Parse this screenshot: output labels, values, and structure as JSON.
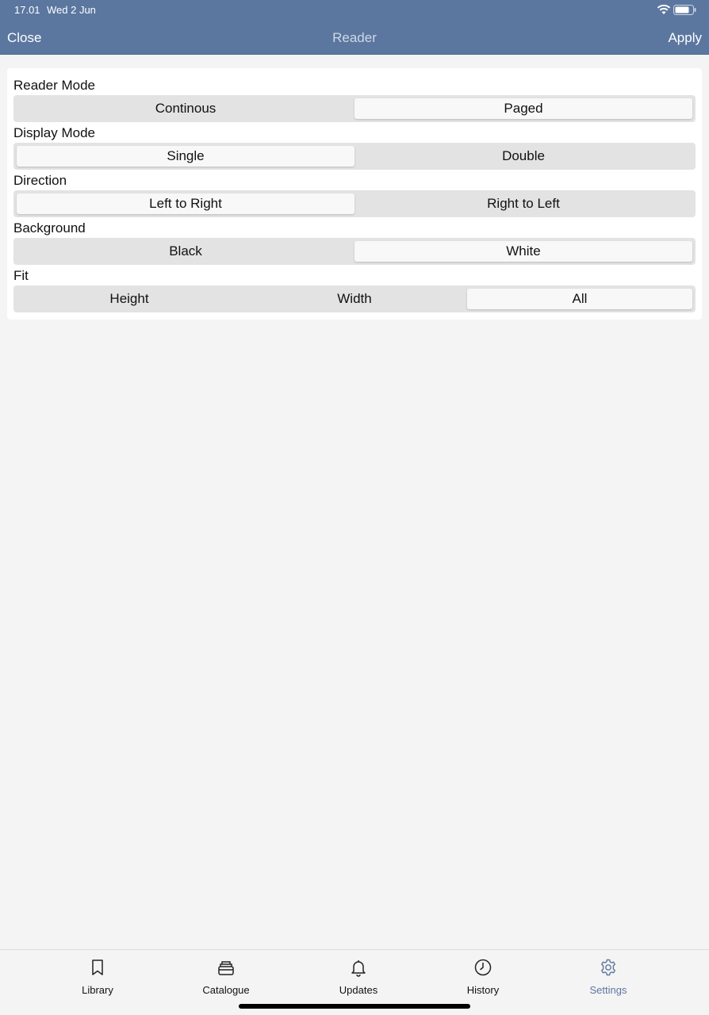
{
  "status": {
    "time": "17.01",
    "date": "Wed 2 Jun"
  },
  "nav": {
    "close_label": "Close",
    "title": "Reader",
    "apply_label": "Apply"
  },
  "settings": [
    {
      "label": "Reader Mode",
      "options": [
        "Continous",
        "Paged"
      ],
      "selected": "Paged"
    },
    {
      "label": "Display Mode",
      "options": [
        "Single",
        "Double"
      ],
      "selected": "Single"
    },
    {
      "label": "Direction",
      "options": [
        "Left to Right",
        "Right to Left"
      ],
      "selected": "Left to Right"
    },
    {
      "label": "Background",
      "options": [
        "Black",
        "White"
      ],
      "selected": "White"
    },
    {
      "label": "Fit",
      "options": [
        "Height",
        "Width",
        "All"
      ],
      "selected": "All"
    }
  ],
  "tabbar": {
    "items": [
      {
        "label": "Library",
        "icon": "bookmark-icon"
      },
      {
        "label": "Catalogue",
        "icon": "catalogue-icon"
      },
      {
        "label": "Updates",
        "icon": "bell-icon"
      },
      {
        "label": "History",
        "icon": "clock-icon"
      },
      {
        "label": "Settings",
        "icon": "gear-icon"
      }
    ],
    "active": "Settings"
  },
  "colors": {
    "header": "#5b77a0",
    "accent": "#5b77a0",
    "background": "#f4f4f4"
  }
}
